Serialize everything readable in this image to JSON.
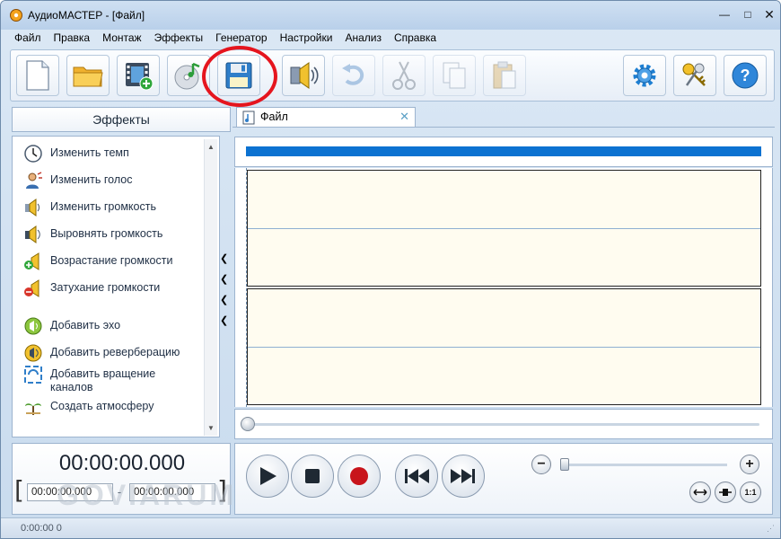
{
  "window": {
    "title": "АудиоМАСТЕР - [Файл]"
  },
  "menu": [
    "Файл",
    "Правка",
    "Монтаж",
    "Эффекты",
    "Генератор",
    "Настройки",
    "Анализ",
    "Справка"
  ],
  "effects": {
    "header": "Эффекты",
    "items": [
      {
        "label": "Изменить темп",
        "icon": "clock-icon"
      },
      {
        "label": "Изменить голос",
        "icon": "person-voice-icon"
      },
      {
        "label": "Изменить громкость",
        "icon": "volume-change-icon"
      },
      {
        "label": "Выровнять громкость",
        "icon": "volume-level-icon"
      },
      {
        "label": "Возрастание громкости",
        "icon": "volume-up-icon"
      },
      {
        "label": "Затухание громкости",
        "icon": "volume-down-icon"
      },
      {
        "label": "Добавить эхо",
        "icon": "echo-icon"
      },
      {
        "label": "Добавить реверберацию",
        "icon": "reverb-icon"
      },
      {
        "label": "Добавить вращение каналов",
        "icon": "rotate-channels-icon"
      },
      {
        "label": "Создать атмосферу",
        "icon": "atmosphere-icon"
      }
    ]
  },
  "file_tab": {
    "label": "Файл"
  },
  "time": {
    "current": "00:00:00.000",
    "start": "00:00:00.000",
    "end": "00:00:00.000",
    "separator": "-"
  },
  "status": {
    "text": "0:00:00 0"
  },
  "watermark": "GOVIARUM",
  "zoom": {
    "minus": "−",
    "plus": "+",
    "fit_label": "1:1"
  },
  "colors": {
    "highlight": "#e5151e",
    "accent": "#0c72d1"
  }
}
